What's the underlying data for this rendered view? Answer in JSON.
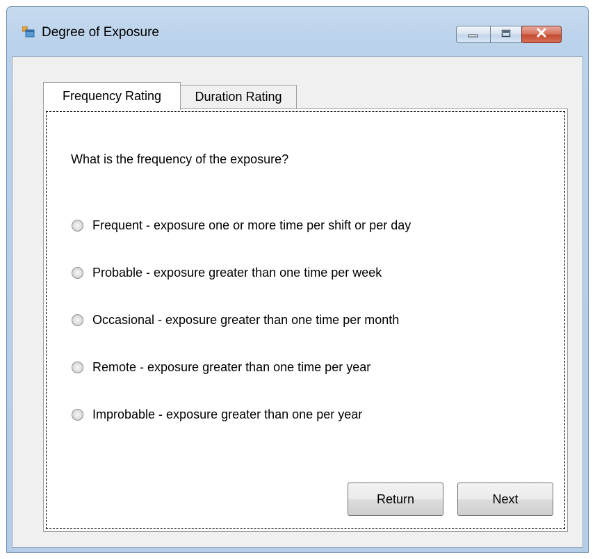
{
  "window": {
    "title": "Degree of Exposure"
  },
  "tabs": [
    {
      "label": "Frequency Rating",
      "active": true
    },
    {
      "label": "Duration Rating",
      "active": false
    }
  ],
  "frequency_tab": {
    "question": "What is the frequency of the exposure?",
    "options": [
      {
        "label": "Frequent - exposure one or more time per shift or per day",
        "checked": false
      },
      {
        "label": "Probable - exposure greater than one time per week",
        "checked": false
      },
      {
        "label": "Occasional - exposure greater than one time per month",
        "checked": false
      },
      {
        "label": "Remote - exposure greater than one time per year",
        "checked": false
      },
      {
        "label": "Improbable - exposure greater than one per year",
        "checked": false
      }
    ]
  },
  "buttons": {
    "return_label": "Return",
    "next_label": "Next"
  },
  "icons": {
    "app": "form-window-icon",
    "minimize": "minimize-icon",
    "maximize": "maximize-icon",
    "close": "close-icon",
    "radio": "radio-button-icon"
  },
  "colors": {
    "window_frame": "#b9d1ea",
    "client_background": "#f0f0f0",
    "close_button": "#c24a30"
  }
}
